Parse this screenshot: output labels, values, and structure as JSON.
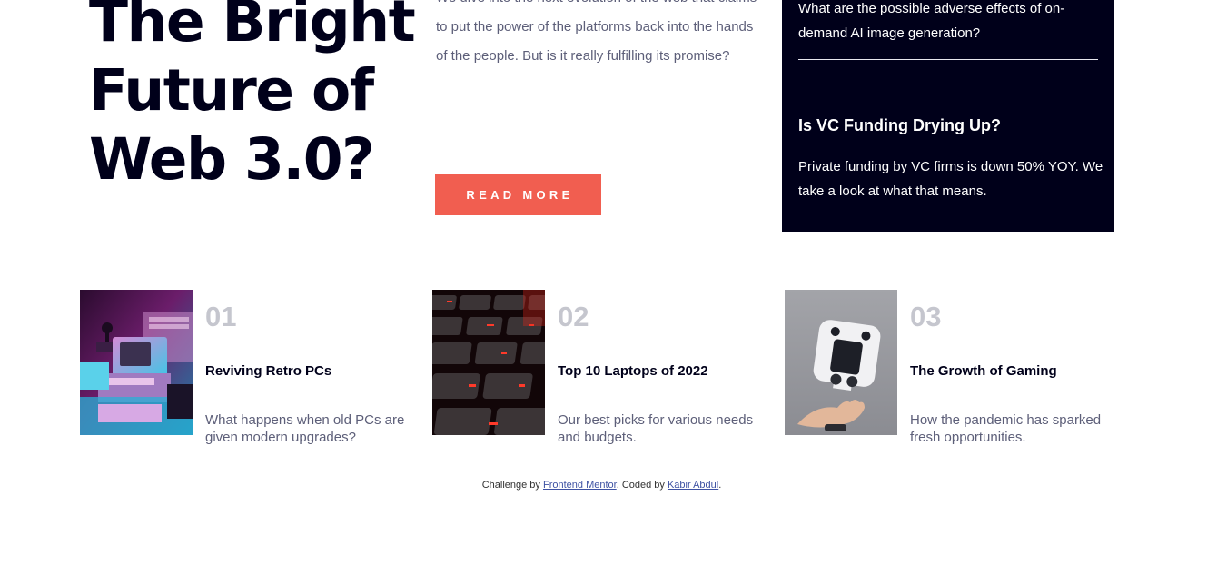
{
  "hero": {
    "title_line1": "The Bright",
    "title_line2": "Future of",
    "title_line3": "Web 3.0?",
    "description": "We dive into the next evolution of the web that claims to put the power of the platforms back into the hands of the people. But is it really fulfilling its promise?",
    "read_more_label": "READ MORE"
  },
  "new_panel": {
    "items": [
      {
        "description": "What are the possible adverse effects of on-demand AI image generation?"
      },
      {
        "title": "Is VC Funding Drying Up?",
        "description": "Private funding by VC firms is down 50% YOY. We take a look at what that means."
      }
    ]
  },
  "cards": [
    {
      "number": "01",
      "title": "Reviving Retro PCs",
      "description": "What happens when old PCs are given modern upgrades?",
      "image": "retro-pc-image"
    },
    {
      "number": "02",
      "title": "Top 10 Laptops of 2022",
      "description": "Our best picks for various needs and budgets.",
      "image": "laptop-keyboard-image"
    },
    {
      "number": "03",
      "title": "The Growth of Gaming",
      "description": "How the pandemic has sparked fresh opportunities.",
      "image": "game-controller-image"
    }
  ],
  "attribution": {
    "prefix": "Challenge by ",
    "link1": "Frontend Mentor",
    "middle": ". Coded by ",
    "link2": "Kabir Abdul",
    "suffix": "."
  },
  "colors": {
    "accent": "#f15e50",
    "dark_navy": "#00001a",
    "grayish_blue": "#5d5f79",
    "number_gray": "#c5c6ce",
    "off_white": "#ffffff"
  }
}
